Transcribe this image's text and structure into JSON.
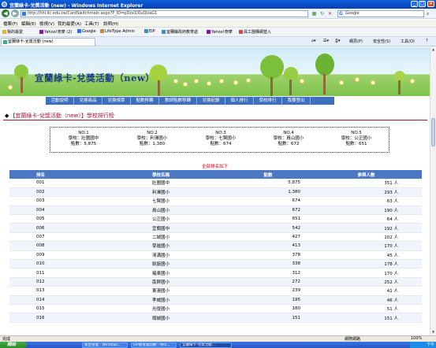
{
  "window": {
    "title": "宜蘭綠卡-兌獎活動 (new) - Windows Internet Explorer",
    "min_glyph": "_",
    "max_glyph": "□",
    "close_glyph": "×"
  },
  "address_bar": {
    "url": "http://hhl.ilc.edu.tw/CardSwitchmain.aspx?P_ID=pDzx1lDuQUaG1",
    "search_placeholder": "Google"
  },
  "menu": [
    "檔案(F)",
    "編輯(E)",
    "檢視(V)",
    "我的最愛(A)",
    "工具(T)",
    "說明(H)"
  ],
  "favorites": [
    "我的最愛",
    "Yahoo!奇摩 (2)",
    "Google",
    "LifeType Admin",
    "EIP",
    "宜蘭縣政府教育處",
    "Yahoo!奇摩",
    "員工團購網登入"
  ],
  "tab": {
    "label": "宜蘭綠卡-兌獎活動 (new)"
  },
  "tab_tools": [
    "網頁(P)",
    "安全性(S)",
    "工具(O)"
  ],
  "banner": {
    "title": "宜蘭綠卡-兌獎活動（new）"
  },
  "nav": [
    "活動說明",
    "兌換商品",
    "兌換規章",
    "點數移轉",
    "教師點數移轉",
    "兌換紀錄",
    "個人排行",
    "學校排行",
    "我要登出"
  ],
  "heading": "【宜蘭綠卡-兌獎活動（new）】學校排行榜",
  "top5": [
    {
      "no": "NO.1",
      "school": "學校：壯圍國中",
      "points": "點數：5,875"
    },
    {
      "no": "NO.2",
      "school": "學校：利澤國小",
      "points": "點數：1,380"
    },
    {
      "no": "NO.3",
      "school": "學校：七賢國小",
      "points": "點數：674"
    },
    {
      "no": "NO.4",
      "school": "學校：員山國小",
      "points": "點數：672"
    },
    {
      "no": "NO.5",
      "school": "學校：公正國小",
      "points": "點數：651"
    }
  ],
  "all_note": "全部排名如下",
  "table": {
    "headers": {
      "rank": "排名",
      "school": "學校名稱",
      "points": "點數",
      "people": "參與人數"
    },
    "rows": [
      {
        "rank": "001",
        "school": "壯圍國中",
        "points": "5,875",
        "people": "351 人"
      },
      {
        "rank": "002",
        "school": "利澤國小",
        "points": "1,380",
        "people": "293 人"
      },
      {
        "rank": "003",
        "school": "七賢國小",
        "points": "674",
        "people": "63 人"
      },
      {
        "rank": "004",
        "school": "員山國小",
        "points": "672",
        "people": "190 人"
      },
      {
        "rank": "005",
        "school": "公正國小",
        "points": "651",
        "people": "64 人"
      },
      {
        "rank": "006",
        "school": "宜蘭國中",
        "points": "542",
        "people": "192 人"
      },
      {
        "rank": "007",
        "school": "二城國小",
        "points": "427",
        "people": "102 人"
      },
      {
        "rank": "008",
        "school": "學進國小",
        "points": "413",
        "people": "170 人"
      },
      {
        "rank": "009",
        "school": "清溝國小",
        "points": "378",
        "people": "45 人"
      },
      {
        "rank": "010",
        "school": "凱旋國小",
        "points": "338",
        "people": "178 人"
      },
      {
        "rank": "011",
        "school": "羅東國小",
        "points": "312",
        "people": "170 人"
      },
      {
        "rank": "012",
        "school": "南屏國小",
        "points": "272",
        "people": "252 人"
      },
      {
        "rank": "013",
        "school": "東澳國小",
        "points": "239",
        "people": "41 人"
      },
      {
        "rank": "014",
        "school": "孝威國小",
        "points": "195",
        "people": "46 人"
      },
      {
        "rank": "015",
        "school": "光復國小",
        "points": "180",
        "people": "51 人"
      },
      {
        "rank": "016",
        "school": "頭城國小",
        "points": "151",
        "people": "151 人"
      }
    ]
  },
  "status": {
    "left": "完成",
    "zone": "網際網路",
    "zoom": "100%"
  },
  "taskbar": {
    "start": "開始",
    "tasks": [
      "後台管理 - Windows...",
      "EIP教育資訊網 - Win...",
      "宜蘭綠卡-兌獎活動..."
    ],
    "clock": "下午"
  },
  "colors": {
    "nav_bg": "#3d6fbf",
    "table_header": "#4a78c2",
    "heading": "#b0133c",
    "note_red": "#d6001c"
  }
}
